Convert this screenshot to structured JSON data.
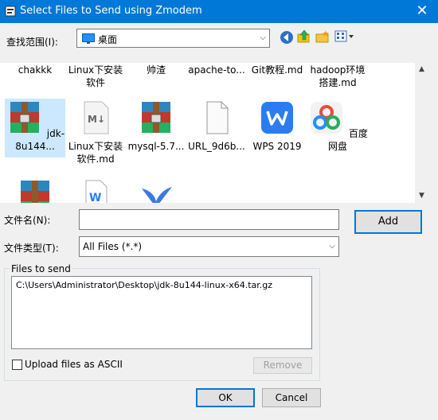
{
  "window": {
    "title": "Select Files to Send using Zmodem",
    "close_glyph": "✕"
  },
  "lookin": {
    "label": "查找范围(I):",
    "value": "桌面"
  },
  "icons": {
    "back": "back-icon",
    "up": "up-folder-icon",
    "newfolder": "new-folder-icon",
    "views": "view-menu-icon"
  },
  "files_row1": [
    {
      "name": "chakkk"
    },
    {
      "name": "Linux下安装软件"
    },
    {
      "name": "帅渣"
    },
    {
      "name": "apache-to..."
    },
    {
      "name": "Git教程.md"
    },
    {
      "name": "hadoop环境搭建.md"
    }
  ],
  "files_row2": [
    {
      "name": "jdk-8u144...",
      "icon": "archive-icon",
      "selected": true
    },
    {
      "name": "Linux下安装软件.md",
      "icon": "markdown-icon"
    },
    {
      "name": "mysql-5.7...",
      "icon": "archive-icon"
    },
    {
      "name": "URL_9d6b...",
      "icon": "blank-file-icon"
    },
    {
      "name": "WPS 2019",
      "icon": "wps-icon"
    },
    {
      "name": "百度网盘",
      "icon": "baidu-netdisk-icon"
    }
  ],
  "files_row3": [
    {
      "icon": "archive-icon"
    },
    {
      "icon": "word-doc-icon"
    },
    {
      "icon": "bird-app-icon"
    }
  ],
  "filename": {
    "label": "文件名(N):",
    "value": ""
  },
  "filetype": {
    "label": "文件类型(T):",
    "value": "All Files (*.*)"
  },
  "buttons": {
    "add": "Add",
    "remove": "Remove",
    "ok": "OK",
    "cancel": "Cancel"
  },
  "files_to_send": {
    "label": "Files to send",
    "items": [
      "C:\\Users\\Administrator\\Desktop\\jdk-8u144-linux-x64.tar.gz"
    ]
  },
  "ascii": {
    "label": "Upload files as ASCII",
    "checked": false
  },
  "colors": {
    "titlebar": "#0078d7",
    "selection": "#cce8ff",
    "archive_red": "#c0392b",
    "archive_green": "#27ae60",
    "archive_blue": "#2e86c1",
    "wps_blue": "#2b7cf0"
  }
}
